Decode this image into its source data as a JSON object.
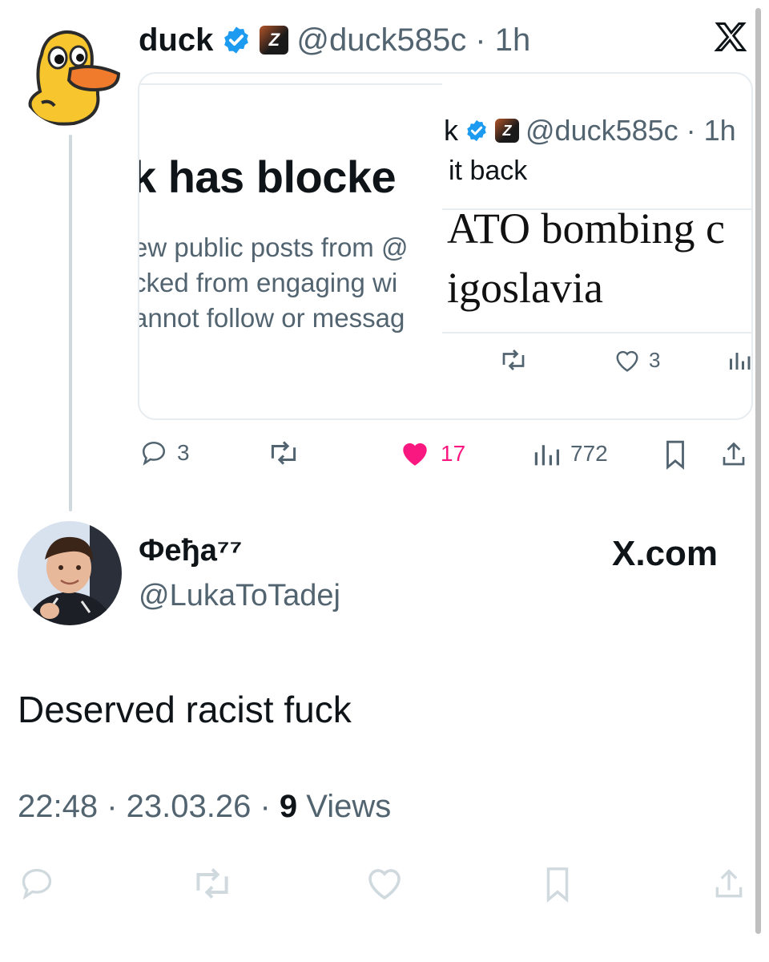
{
  "tweet": {
    "author_name": "duck",
    "handle_time": "@duck585c · 1h",
    "platform_logo": "x-logo",
    "actions": {
      "replies": "3",
      "likes": "17",
      "views": "772"
    }
  },
  "quote_card": {
    "left_screenshot": {
      "headline": "k has blocke",
      "line1": "ew public posts from @",
      "line2": "cked from engaging wi",
      "line3": "annot follow or messag"
    },
    "right_screenshot": {
      "header_handle": "@duck585c · 1h",
      "header_prefix": "k",
      "text": "it back",
      "headline_line1": "ATO bombing c",
      "headline_line2": "igoslavia",
      "likes": "3"
    }
  },
  "reply": {
    "display_name": "Феђа⁷⁷",
    "handle": "@LukaToTadej",
    "site_label": "X.com",
    "text": "Deserved racist fuck",
    "time_date": "22:48 · 23.03.26 · ",
    "views_count": "9",
    "views_label": " Views"
  },
  "colors": {
    "like_active": "#f91880",
    "verified": "#1d9bf0",
    "muted": "#536471"
  }
}
